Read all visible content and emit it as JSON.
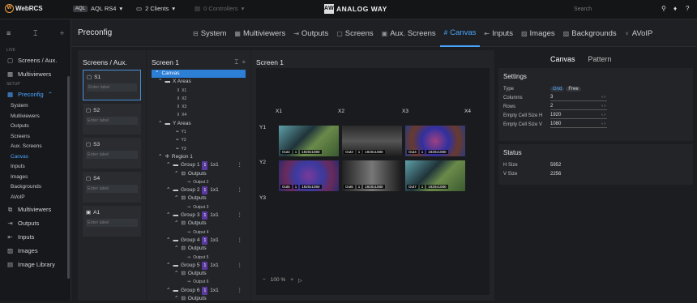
{
  "topbar": {
    "logo_text": "WebRCS",
    "device_badge": "AQL",
    "device_name": "AQL RS4",
    "clients": "2 Clients",
    "controllers": "0 Controllers",
    "brand": "ANALOG WAY",
    "search_placeholder": "Search"
  },
  "sidebar": {
    "live_section": "LIVE",
    "setup_section": "SETUP",
    "items_live": [
      {
        "label": "Screens / Aux."
      },
      {
        "label": "Multiviewers"
      }
    ],
    "preconfig_label": "Preconfig",
    "preconfig_sub": [
      "System",
      "Multiviewers",
      "Outputs",
      "Screens",
      "Aux. Screens",
      "Canvas",
      "Inputs",
      "Images",
      "Backgrounds",
      "AVoIP"
    ],
    "items_bottom": [
      {
        "label": "Multiviewers"
      },
      {
        "label": "Outputs"
      },
      {
        "label": "Inputs"
      },
      {
        "label": "Images"
      },
      {
        "label": "Image Library"
      }
    ]
  },
  "header": {
    "title": "Preconfig",
    "tabs": [
      "System",
      "Multiviewers",
      "Outputs",
      "Screens",
      "Aux. Screens",
      "Canvas",
      "Inputs",
      "Images",
      "Backgrounds",
      "AVoIP"
    ],
    "active_tab": "Canvas"
  },
  "screens_col": {
    "title": "Screens / Aux.",
    "items": [
      {
        "name": "S1",
        "placeholder": "Enter label"
      },
      {
        "name": "S2",
        "placeholder": "Enter label"
      },
      {
        "name": "S3",
        "placeholder": "Enter label"
      },
      {
        "name": "S4",
        "placeholder": "Enter label"
      },
      {
        "name": "A1",
        "placeholder": "Enter label"
      }
    ]
  },
  "tree_col": {
    "title": "Screen 1",
    "canvas": "Canvas",
    "x_areas": "X Areas",
    "x_items": [
      "X1",
      "X2",
      "X3",
      "X4"
    ],
    "y_areas": "Y Areas",
    "y_items": [
      "Y1",
      "Y2",
      "Y3"
    ],
    "region": "Region 1",
    "groups": [
      {
        "name": "Group 1",
        "num": "1",
        "size": "1x1",
        "outputs": "Outputs",
        "output": "Output 2"
      },
      {
        "name": "Group 2",
        "num": "1",
        "size": "1x1",
        "outputs": "Outputs",
        "output": "Output 3"
      },
      {
        "name": "Group 3",
        "num": "1",
        "size": "1x1",
        "outputs": "Outputs",
        "output": "Output 4"
      },
      {
        "name": "Group 4",
        "num": "1",
        "size": "1x1",
        "outputs": "Outputs",
        "output": "Output 5"
      },
      {
        "name": "Group 5",
        "num": "1",
        "size": "1x1",
        "outputs": "Outputs",
        "output": "Output 6"
      },
      {
        "name": "Group 6",
        "num": "1",
        "size": "1x1",
        "outputs": "Outputs"
      }
    ]
  },
  "canvas_col": {
    "title": "Screen 1",
    "x_labels": [
      "X1",
      "X2",
      "X3",
      "X4"
    ],
    "y_labels": [
      "Y1",
      "Y2",
      "Y3"
    ],
    "cells": [
      {
        "out": "Out2",
        "num": "1",
        "res": "1920x1080"
      },
      {
        "out": "Out3",
        "num": "1",
        "res": "1920x1080"
      },
      {
        "out": "Out4",
        "num": "1",
        "res": "1920x1080"
      },
      {
        "out": "Out5",
        "num": "1",
        "res": "1920x1080"
      },
      {
        "out": "Out6",
        "num": "1",
        "res": "1920x1080"
      },
      {
        "out": "Out7",
        "num": "1",
        "res": "1920x1080"
      }
    ],
    "zoom": "100 %"
  },
  "settings": {
    "tabs": [
      "Canvas",
      "Pattern"
    ],
    "title": "Settings",
    "type_label": "Type",
    "type_options": [
      "Grid",
      "Free"
    ],
    "columns_label": "Columns",
    "columns_value": "3",
    "rows_label": "Rows",
    "rows_value": "2",
    "cell_h_label": "Empty Cell Size H",
    "cell_h_value": "1920",
    "cell_v_label": "Empty Cell Size V",
    "cell_v_value": "1080",
    "status_title": "Status",
    "hsize_label": "H Size",
    "hsize_value": "5952",
    "vsize_label": "V Size",
    "vsize_value": "2256"
  }
}
